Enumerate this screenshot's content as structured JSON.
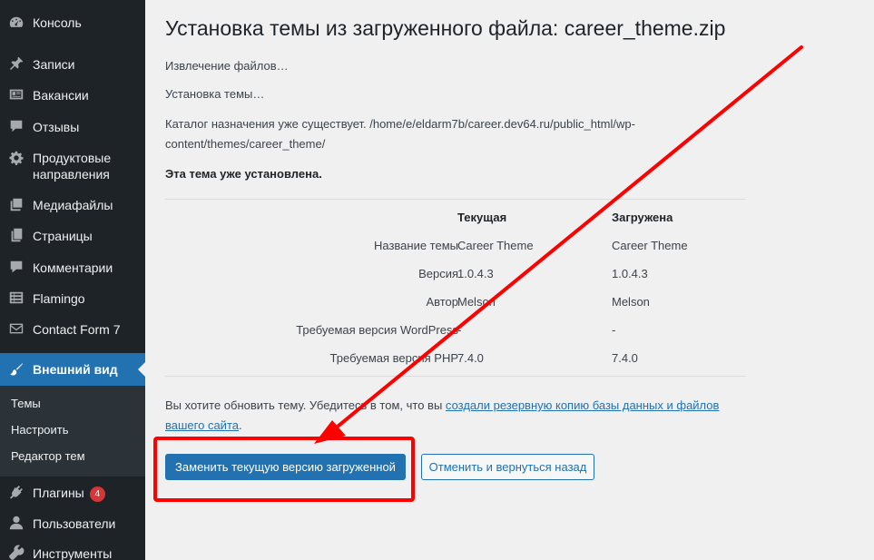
{
  "sidebar": {
    "items": [
      {
        "label": "Консоль",
        "icon": "dashboard-icon"
      },
      {
        "label": "Записи",
        "icon": "pin-icon"
      },
      {
        "label": "Вакансии",
        "icon": "id-card-icon"
      },
      {
        "label": "Отзывы",
        "icon": "speech-bubble-icon"
      },
      {
        "label": "Продуктовые направления",
        "label_line1": "Продуктовые",
        "label_line2": "направления",
        "icon": "gear-icon"
      },
      {
        "label": "Медиафайлы",
        "icon": "media-icon"
      },
      {
        "label": "Страницы",
        "icon": "pages-icon"
      },
      {
        "label": "Комментарии",
        "icon": "comment-icon"
      },
      {
        "label": "Flamingo",
        "icon": "list-icon"
      },
      {
        "label": "Contact Form 7",
        "icon": "mail-icon"
      },
      {
        "label": "Внешний вид",
        "icon": "paintbrush-icon"
      },
      {
        "label": "Плагины",
        "icon": "plugin-icon",
        "badge": "4"
      },
      {
        "label": "Пользователи",
        "icon": "users-icon"
      },
      {
        "label": "Инструменты",
        "icon": "wrench-icon"
      }
    ],
    "submenu": [
      "Темы",
      "Настроить",
      "Редактор тем"
    ]
  },
  "main": {
    "title": "Установка темы из загруженного файла: career_theme.zip",
    "steps": [
      "Извлечение файлов…",
      "Установка темы…"
    ],
    "dest_line1": "Каталог назначения уже существует. /home/e/eldarm7b/career.dev64.ru/public_html/wp-",
    "dest_line2": "content/themes/career_theme/",
    "already_installed": "Эта тема уже установлена.",
    "table": {
      "headers": [
        "Текущая",
        "Загружена"
      ],
      "rows": [
        {
          "label": "Название темы",
          "current": "Career Theme",
          "uploaded": "Career Theme"
        },
        {
          "label": "Версия",
          "current": "1.0.4.3",
          "uploaded": "1.0.4.3"
        },
        {
          "label": "Автор",
          "current": "Melson",
          "uploaded": "Melson"
        },
        {
          "label": "Требуемая версия WordPress",
          "current": "-",
          "uploaded": "-"
        },
        {
          "label": "Требуемая версия PHP",
          "current": "7.4.0",
          "uploaded": "7.4.0"
        }
      ]
    },
    "update_text": "Вы хотите обновить тему. Убедитесь в том, что вы ",
    "backup_link_line1": "создали резервную копию базы данных и файлов",
    "backup_link_line2": "вашего сайта",
    "update_text_end": ".",
    "replace_button": "Заменить текущую версию загруженной",
    "cancel_button": "Отменить и вернуться назад"
  },
  "colors": {
    "sidebar_bg": "#1d2327",
    "accent": "#2271b1",
    "annotation_red": "#ff0000",
    "badge": "#d63638"
  }
}
